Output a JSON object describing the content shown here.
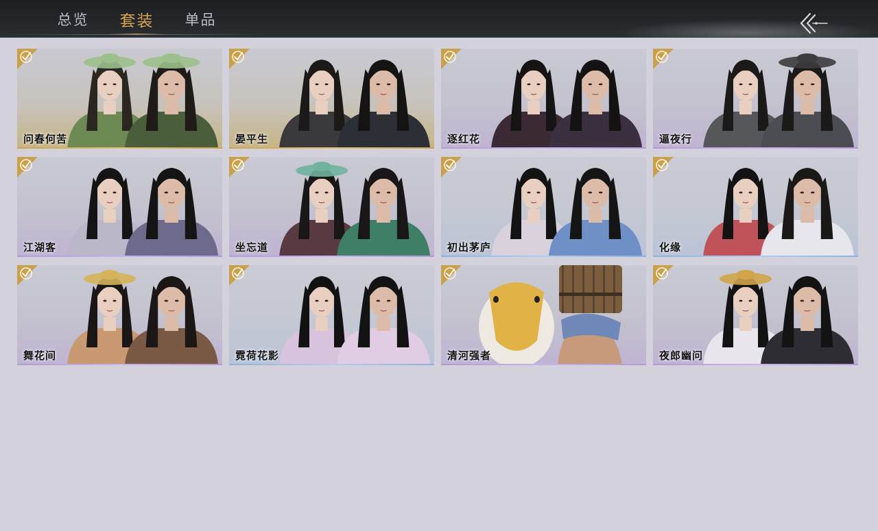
{
  "tabs": [
    {
      "label": "总览",
      "active": false
    },
    {
      "label": "套装",
      "active": true
    },
    {
      "label": "单品",
      "active": false
    }
  ],
  "back_button": {
    "icon": "back-arrow-icon"
  },
  "accent": {
    "active_tab": "#d6a252",
    "badge": "#c9a04e",
    "rarity_gold": "#e3c06a",
    "rarity_purple": "#c8b3ec",
    "rarity_blue": "#b5cdee"
  },
  "outfits": [
    {
      "name": "问春何苦",
      "owned": true,
      "rarity": "gold",
      "pair": "female-male",
      "theme": "green-hats"
    },
    {
      "name": "晏平生",
      "owned": true,
      "rarity": "gold",
      "pair": "female-male",
      "theme": "dark-robes"
    },
    {
      "name": "逐红花",
      "owned": true,
      "rarity": "purple",
      "pair": "female-male",
      "theme": "crimson-dark"
    },
    {
      "name": "逼夜行",
      "owned": true,
      "rarity": "purple",
      "pair": "female-male",
      "theme": "grey-fur"
    },
    {
      "name": "江湖客",
      "owned": true,
      "rarity": "purple",
      "pair": "female-male",
      "theme": "lavender-robes"
    },
    {
      "name": "坐忘道",
      "owned": true,
      "rarity": "purple",
      "pair": "female-male",
      "theme": "jade-green"
    },
    {
      "name": "初出茅庐",
      "owned": true,
      "rarity": "blue",
      "pair": "female-male",
      "theme": "blue-white"
    },
    {
      "name": "化缘",
      "owned": true,
      "rarity": "blue",
      "pair": "female-male",
      "theme": "red-white"
    },
    {
      "name": "舞花间",
      "owned": true,
      "rarity": "purple",
      "pair": "female-male",
      "theme": "gold-dancer"
    },
    {
      "name": "霓荷花影",
      "owned": true,
      "rarity": "blue",
      "pair": "female-male",
      "theme": "pink-lotus"
    },
    {
      "name": "清河强者",
      "owned": true,
      "rarity": "purple",
      "pair": "duck-bucket",
      "theme": "mascot"
    },
    {
      "name": "夜郎幽问",
      "owned": true,
      "rarity": "purple",
      "pair": "female-male",
      "theme": "white-butterfly"
    }
  ]
}
